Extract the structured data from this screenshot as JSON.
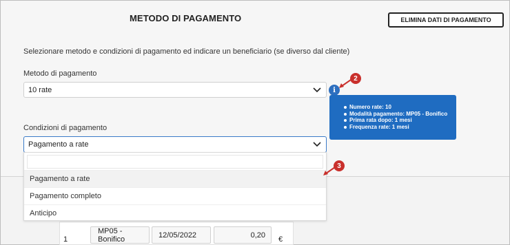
{
  "header": {
    "title": "METODO DI PAGAMENTO",
    "clear_button": "ELIMINA DATI DI PAGAMENTO"
  },
  "instructions": "Selezionare metodo e condizioni di pagamento ed indicare un beneficiario (se diverso dal cliente)",
  "payment_method": {
    "label": "Metodo di pagamento",
    "value": "10 rate"
  },
  "info": {
    "icon": "i",
    "tooltip_items": [
      "Numero rate: 10",
      "Modalità pagamento: MP05 - Bonifico",
      "Prima rata dopo: 1 mesi",
      "Frequenza rate: 1 mesi"
    ]
  },
  "payment_conditions": {
    "label": "Condizioni di pagamento",
    "value": "Pagamento a rate",
    "search_value": "",
    "options": [
      "Pagamento a rate",
      "Pagamento completo",
      "Anticipo"
    ]
  },
  "callouts": {
    "badge_2": "2",
    "badge_3": "3",
    "color": "#c9302c"
  },
  "installment_row": {
    "number": "1",
    "mode": "MP05 - Bonifico",
    "date": "12/05/2022",
    "amount": "0,20",
    "currency": "€"
  },
  "colors": {
    "accent": "#1f6cc1",
    "badge": "#c9302c"
  }
}
